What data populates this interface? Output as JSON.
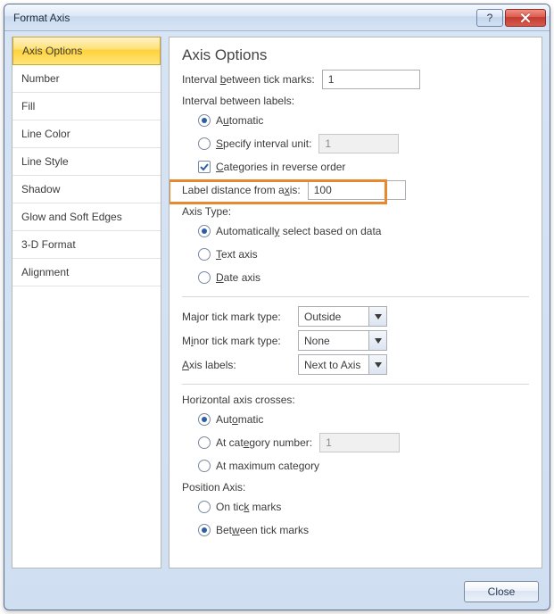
{
  "window": {
    "title": "Format Axis"
  },
  "sidebar": {
    "items": [
      {
        "label": "Axis Options",
        "selected": true
      },
      {
        "label": "Number"
      },
      {
        "label": "Fill"
      },
      {
        "label": "Line Color"
      },
      {
        "label": "Line Style"
      },
      {
        "label": "Shadow"
      },
      {
        "label": "Glow and Soft Edges"
      },
      {
        "label": "3-D Format"
      },
      {
        "label": "Alignment"
      }
    ]
  },
  "main": {
    "heading": "Axis Options",
    "interval_tick_label_pre": "Interval ",
    "interval_tick_label_u": "b",
    "interval_tick_label_post": "etween tick marks:",
    "interval_tick_value": "1",
    "interval_labels_label": "Interval between labels:",
    "interval_labels_options": {
      "automatic_pre": "A",
      "automatic_u": "u",
      "automatic_post": "tomatic",
      "automatic_checked": true,
      "specify_u": "S",
      "specify_post": "pecify interval unit:",
      "specify_checked": false,
      "specify_value": "1"
    },
    "reverse_order_u": "C",
    "reverse_order_post": "ategories in reverse order",
    "reverse_order_checked": true,
    "label_distance_pre": "Label distance from a",
    "label_distance_u": "x",
    "label_distance_post": "is:",
    "label_distance_value": "100",
    "axis_type_label": "Axis Type:",
    "axis_type_options": {
      "auto_pre": "Automaticall",
      "auto_u": "y",
      "auto_post": " select based on data",
      "auto_checked": true,
      "text_u": "T",
      "text_post": "ext axis",
      "text_checked": false,
      "date_u": "D",
      "date_post": "ate axis",
      "date_checked": false
    },
    "major_label_pre": "Ma",
    "major_label_u": "j",
    "major_label_post": "or tick mark type:",
    "major_value": "Outside",
    "minor_label_pre": "M",
    "minor_label_u": "i",
    "minor_label_post": "nor tick mark type:",
    "minor_value": "None",
    "axis_labels_u": "A",
    "axis_labels_post": "xis labels:",
    "axis_labels_value": "Next to Axis",
    "crosses_label": "Horizontal axis crosses:",
    "crosses_options": {
      "auto_pre": "Aut",
      "auto_u": "o",
      "auto_post": "matic",
      "auto_checked": true,
      "at_pre": "At cat",
      "at_u": "e",
      "at_post": "gory number:",
      "at_checked": false,
      "at_value": "1",
      "max_pre": "At maximum cate",
      "max_u": "g",
      "max_post": "ory",
      "max_checked": false
    },
    "position_label": "Position Axis:",
    "position_options": {
      "on_pre": "On tic",
      "on_u": "k",
      "on_post": " marks",
      "on_checked": false,
      "between_pre": "Bet",
      "between_u": "w",
      "between_post": "een tick marks",
      "between_checked": true
    }
  },
  "footer": {
    "close_label": "Close"
  }
}
